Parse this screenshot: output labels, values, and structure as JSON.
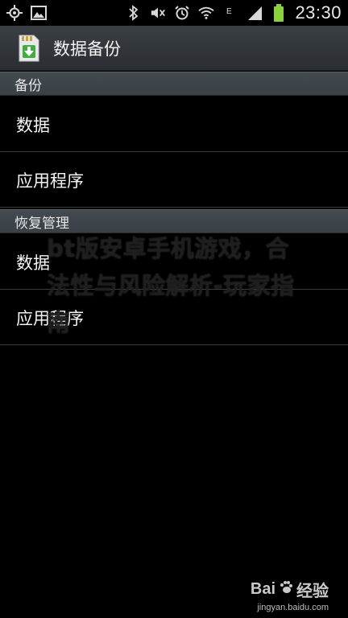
{
  "status_bar": {
    "time": "23:30",
    "left_icons": [
      "gps-icon",
      "image-icon"
    ],
    "right_icons": [
      "bluetooth-icon",
      "mute-icon",
      "alarm-icon",
      "wifi-icon",
      "e-network-icon",
      "signal-icon",
      "battery-icon"
    ],
    "network_label": "E"
  },
  "title_bar": {
    "title": "数据备份",
    "icon": "sd-card-download-icon"
  },
  "sections": [
    {
      "header": "备份",
      "items": [
        "数据",
        "应用程序"
      ]
    },
    {
      "header": "恢复管理",
      "items": [
        "数据",
        "应用程序"
      ]
    }
  ],
  "overlay": {
    "text": "bt版安卓手机游戏，合法性与风险解析-玩家指南"
  },
  "watermark": {
    "logo_prefix": "Bai",
    "logo_suffix": "经验",
    "url": "jingyan.baidu.com"
  },
  "colors": {
    "background": "#000000",
    "title_bar": "#2f3438",
    "section_header": "#3e454a",
    "battery": "#8bd13c",
    "divider": "#3b3b3b"
  }
}
